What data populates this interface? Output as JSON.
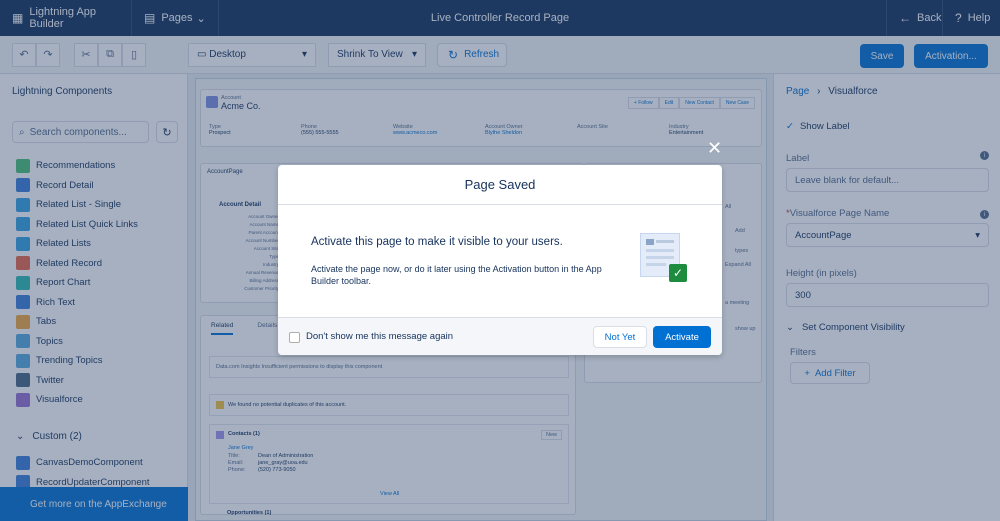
{
  "topbar": {
    "app_name": "Lightning App Builder",
    "pages_label": "Pages",
    "page_title": "Live Controller Record Page",
    "back_label": "Back",
    "help_label": "Help"
  },
  "toolbar": {
    "device": "Desktop",
    "view_mode": "Shrink To View",
    "refresh_label": "Refresh",
    "save_label": "Save",
    "activation_label": "Activation..."
  },
  "left_panel": {
    "title": "Lightning Components",
    "search_placeholder": "Search components...",
    "components": [
      {
        "label": "Recommendations",
        "color": "#4bc076"
      },
      {
        "label": "Record Detail",
        "color": "#3b7dd8"
      },
      {
        "label": "Related List - Single",
        "color": "#36a3e3"
      },
      {
        "label": "Related List Quick Links",
        "color": "#36a3e3"
      },
      {
        "label": "Related Lists",
        "color": "#36a3e3"
      },
      {
        "label": "Related Record",
        "color": "#e8664c"
      },
      {
        "label": "Report Chart",
        "color": "#2dbab2"
      },
      {
        "label": "Rich Text",
        "color": "#3b7dd8"
      },
      {
        "label": "Tabs",
        "color": "#f2a73e"
      },
      {
        "label": "Topics",
        "color": "#56aadf"
      },
      {
        "label": "Trending Topics",
        "color": "#56aadf"
      },
      {
        "label": "Twitter",
        "color": "#4a6786"
      },
      {
        "label": "Visualforce",
        "color": "#9a6fd3"
      }
    ],
    "custom_header": "Custom (2)",
    "custom_components": [
      {
        "label": "CanvasDemoComponent",
        "color": "#3b7dd8"
      },
      {
        "label": "RecordUpdaterComponent",
        "color": "#3b7dd8"
      }
    ],
    "appexchange_label": "Get more on the AppExchange"
  },
  "canvas": {
    "record_type": "Account",
    "record_name": "Acme Co.",
    "actions": [
      "+ Follow",
      "Edit",
      "New Contact",
      "New Case"
    ],
    "highlights": [
      {
        "label": "Type",
        "value": "Prospect"
      },
      {
        "label": "Phone",
        "value": "(555) 555-5555"
      },
      {
        "label": "Website",
        "value": "www.acmeco.com"
      },
      {
        "label": "Account Owner",
        "value": "Blythe Sheldon"
      },
      {
        "label": "Account Site",
        "value": ""
      },
      {
        "label": "Industry",
        "value": "Entertainment"
      }
    ],
    "account_page_title": "AccountPage",
    "account_detail_title": "Account Detail",
    "detail_fields": [
      "Account Owner",
      "Account Name",
      "Parent Account",
      "Account Number",
      "Account Site",
      "Type",
      "Industry",
      "Annual Revenue",
      "Billing Address",
      "Customer Priority"
    ],
    "tabs": [
      "Related",
      "Details"
    ],
    "insights_text": "Data.com Insights  Insufficient permissions to display this component",
    "duplicates_text": "We found no potential duplicates of this account.",
    "contacts_header": "Contacts (1)",
    "new_label": "New",
    "contact_name": "Jane Grey",
    "contact_fields": [
      {
        "label": "Title:",
        "value": "Dean of Administration"
      },
      {
        "label": "Email:",
        "value": "jane_gray@uoa.edu"
      },
      {
        "label": "Phone:",
        "value": "(520) 773-9050"
      }
    ],
    "view_all": "View All",
    "opportunities_header": "Opportunities (1)",
    "right_card_snippets": [
      "All",
      "types",
      "Add",
      "Expand All",
      "a meeting",
      "show up"
    ]
  },
  "right_panel": {
    "breadcrumb_root": "Page",
    "breadcrumb_current": "Visualforce",
    "show_label": "Show Label",
    "label_title": "Label",
    "label_placeholder": "Leave blank for default...",
    "vf_page_title": "Visualforce Page Name",
    "vf_page_value": "AccountPage",
    "height_title": "Height (in pixels)",
    "height_value": "300",
    "visibility_title": "Set Component Visibility",
    "filters_title": "Filters",
    "add_filter_label": "Add Filter"
  },
  "modal": {
    "title": "Page Saved",
    "heading": "Activate this page to make it visible to your users.",
    "body": "Activate the page now, or do it later using the Activation button in the App Builder toolbar.",
    "checkbox_label": "Don't show me this message again",
    "not_yet_label": "Not Yet",
    "activate_label": "Activate"
  },
  "colors": {
    "brand": "#0070d2",
    "header": "#16325c",
    "success": "#1e8c3f"
  }
}
